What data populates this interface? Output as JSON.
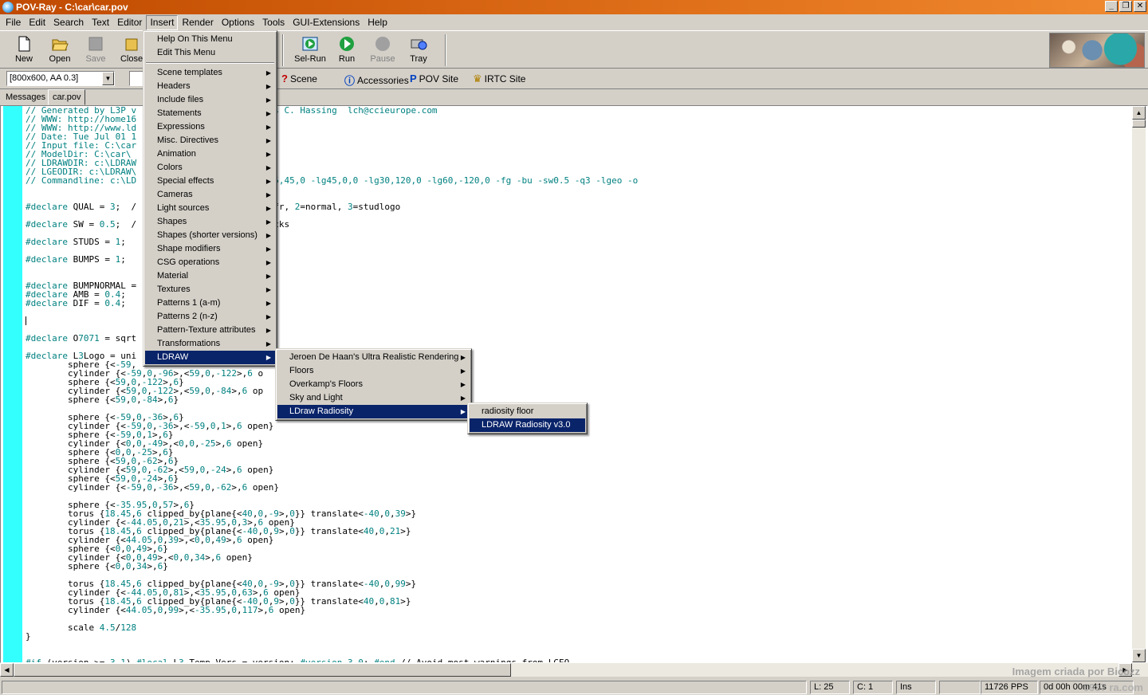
{
  "window": {
    "title": "POV-Ray - C:\\car\\car.pov"
  },
  "menubar": [
    "File",
    "Edit",
    "Search",
    "Text",
    "Editor",
    "Insert",
    "Render",
    "Options",
    "Tools",
    "GUI-Extensions",
    "Help"
  ],
  "toolbar": {
    "new": "New",
    "open": "Open",
    "save": "Save",
    "close": "Close",
    "selrun": "Sel-Run",
    "run": "Run",
    "pause": "Pause",
    "tray": "Tray"
  },
  "toolbar2": {
    "resolution": "[800x600, AA 0.3]",
    "scene": "Scene",
    "accessories": "Accessories",
    "povsite": "POV Site",
    "irtc": "IRTC Site"
  },
  "tabs": {
    "messages": "Messages",
    "file": "car.pov"
  },
  "code_lines": [
    "// Generated by L3P v                   001 Lars C. Hassing  lch@ccieurope.com",
    "// WWW: http://home16                   p.html",
    "// WWW: http://www.ld                   e/l3p",
    "// Date: Tue Jul 01 1",
    "// Input file: C:\\car",
    "// ModelDir: C:\\car\\",
    "// LDRAWDIR: c:\\LDRAW",
    "// LGEODIR: c:\\LDRAW\\",
    "// Commandline: c:\\LD                   dr -cg45,45,0 -lg45,0,0 -lg30,120,0 -lg60,-120,0 -fg -bu -sw0.5 -q3 -lgeo -o",
    "",
    "",
    "#declare QUAL = 3;  /                   1=no refr, 2=normal, 3=studlogo",
    "",
    "#declare SW = 0.5;  /                   two bricks",
    "",
    "#declare STUDS = 1;",
    "",
    "#declare BUMPS = 1;",
    "",
    "",
    "#declare BUMPNORMAL =                   e 20 }",
    "#declare AMB = 0.4;",
    "#declare DIF = 0.4;",
    "",
    "",
    "",
    "#declare O7071 = sqrt",
    "",
    "#declare L3Logo = uni",
    "        sphere {<-59,",
    "        cylinder {<-59,0,-96>,<59,0,-122>,6 o",
    "        sphere {<59,0,-122>,6}",
    "        cylinder {<59,0,-122>,<59,0,-84>,6 op",
    "        sphere {<59,0,-84>,6}",
    "",
    "        sphere {<-59,0,-36>,6}",
    "        cylinder {<-59,0,-36>,<-59,0,1>,6 open}",
    "        sphere {<-59,0,1>,6}",
    "        cylinder {<0,0,-49>,<0,0,-25>,6 open}",
    "        sphere {<0,0,-25>,6}",
    "        sphere {<59,0,-62>,6}",
    "        cylinder {<59,0,-62>,<59,0,-24>,6 open}",
    "        sphere {<59,0,-24>,6}",
    "        cylinder {<-59,0,-36>,<59,0,-62>,6 open}",
    "",
    "        sphere {<-35.95,0,57>,6}",
    "        torus {18.45,6 clipped_by{plane{<40,0,-9>,0}} translate<-40,0,39>}",
    "        cylinder {<-44.05,0,21>,<35.95,0,3>,6 open}",
    "        torus {18.45,6 clipped_by{plane{<-40,0,9>,0}} translate<40,0,21>}",
    "        cylinder {<44.05,0,39>,<0,0,49>,6 open}",
    "        sphere {<0,0,49>,6}",
    "        cylinder {<0,0,49>,<0,0,34>,6 open}",
    "        sphere {<0,0,34>,6}",
    "",
    "        torus {18.45,6 clipped_by{plane{<40,0,-9>,0}} translate<-40,0,99>}",
    "        cylinder {<-44.05,0,81>,<35.95,0,63>,6 open}",
    "        torus {18.45,6 clipped_by{plane{<-40,0,9>,0}} translate<40,0,81>}",
    "        cylinder {<44.05,0,99>,<-35.95,0,117>,6 open}",
    "",
    "        scale 4.5/128",
    "}",
    "",
    "",
    "#if (version >= 3.1) #local L3_Temp_Vers = version; #version 3.0; #end // Avoid most warnings from LGEO"
  ],
  "insert_menu": {
    "top_items": [
      "Help On This Menu",
      "Edit This Menu"
    ],
    "items": [
      "Scene templates",
      "Headers",
      "Include files",
      "Statements",
      "Expressions",
      "Misc. Directives",
      "Animation",
      "Colors",
      "Special effects",
      "Cameras",
      "Light sources",
      "Shapes",
      "Shapes (shorter versions)",
      "Shape modifiers",
      "CSG operations",
      "Material",
      "Textures",
      "Patterns 1 (a-m)",
      "Patterns 2 (n-z)",
      "Pattern-Texture attributes",
      "Transformations",
      "LDRAW"
    ]
  },
  "ldraw_menu": [
    "Jeroen De Haan's Ultra Realistic Rendering",
    "Floors",
    "Overkamp's Floors",
    "Sky and Light",
    "LDraw Radiosity"
  ],
  "radiosity_menu": [
    "radiosity floor",
    "LDRAW Radiosity v3.0"
  ],
  "status": {
    "line": "L: 25",
    "col": "C: 1",
    "mode": "Ins",
    "pps": "11726 PPS",
    "time": "0d 00h 00m 41s"
  },
  "watermark": "Imagem criada por Bicozz",
  "watermark2": "0937               ra.com",
  "colors": {
    "title_bar": "#e0701a",
    "highlight": "#0a246a",
    "gutter": "#33ffff"
  }
}
